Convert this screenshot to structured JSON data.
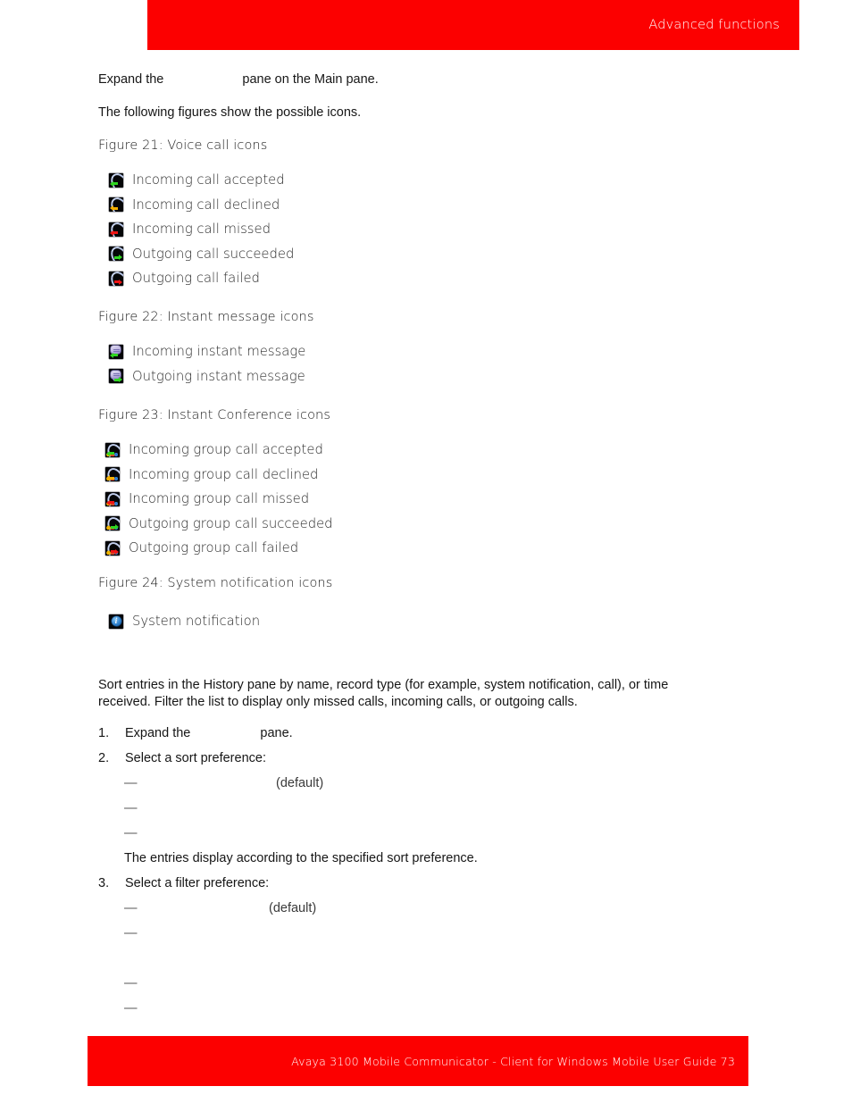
{
  "header": {
    "title": "Advanced functions",
    "banner_color": "#fc0000"
  },
  "intro": {
    "line1_before": "Expand the",
    "line1_after": "pane on the Main pane.",
    "line2": "The following figures show the possible icons."
  },
  "figures": [
    {
      "caption": "Figure 21: Voice call icons",
      "icon_kind": "voice",
      "rows": [
        {
          "label": "Incoming call accepted",
          "icon_name": "incoming-call-accepted-icon",
          "arrow_dir": "left",
          "arrow_color": "green"
        },
        {
          "label": "Incoming call declined",
          "icon_name": "incoming-call-declined-icon",
          "arrow_dir": "left",
          "arrow_color": "amber"
        },
        {
          "label": "Incoming call missed",
          "icon_name": "incoming-call-missed-icon",
          "arrow_dir": "left",
          "arrow_color": "red"
        },
        {
          "label": "Outgoing call succeeded",
          "icon_name": "outgoing-call-succeeded-icon",
          "arrow_dir": "right",
          "arrow_color": "green"
        },
        {
          "label": "Outgoing call failed",
          "icon_name": "outgoing-call-failed-icon",
          "arrow_dir": "right",
          "arrow_color": "red"
        }
      ]
    },
    {
      "caption": "Figure 22: Instant message icons",
      "icon_kind": "im",
      "rows": [
        {
          "label": "Incoming instant message",
          "icon_name": "incoming-instant-message-icon",
          "arrow_dir": "left",
          "arrow_color": "green"
        },
        {
          "label": "Outgoing instant message",
          "icon_name": "outgoing-instant-message-icon",
          "arrow_dir": "right",
          "arrow_color": "green"
        }
      ]
    },
    {
      "caption": "Figure 23: Instant Conference icons",
      "icon_kind": "group",
      "rows": [
        {
          "label": "Incoming group call accepted",
          "icon_name": "incoming-group-call-accepted-icon",
          "arrow_dir": "left",
          "arrow_color": "green"
        },
        {
          "label": "Incoming group call declined",
          "icon_name": "incoming-group-call-declined-icon",
          "arrow_dir": "left",
          "arrow_color": "amber"
        },
        {
          "label": "Incoming group call missed",
          "icon_name": "incoming-group-call-missed-icon",
          "arrow_dir": "left",
          "arrow_color": "red"
        },
        {
          "label": "Outgoing group call succeeded",
          "icon_name": "outgoing-group-call-succeeded-icon",
          "arrow_dir": "right",
          "arrow_color": "green"
        },
        {
          "label": "Outgoing group call failed",
          "icon_name": "outgoing-group-call-failed-icon",
          "arrow_dir": "right",
          "arrow_color": "red"
        }
      ]
    },
    {
      "caption": "Figure 24: System notification icons",
      "icon_kind": "info",
      "rows": [
        {
          "label": "System notification",
          "icon_name": "system-notification-icon",
          "arrow_dir": "none",
          "arrow_color": "none"
        }
      ]
    }
  ],
  "procedure": {
    "intro_paragraph": "Sort entries in the History pane by name, record type (for example, system notification, call), or time received. Filter the list to display only missed calls, incoming calls, or outgoing calls.",
    "step1": {
      "number": "1.",
      "text_before": "Expand the",
      "text_after": "pane."
    },
    "step2": {
      "number": "2.",
      "text": "Select a sort preference:"
    },
    "sort_options": [
      {
        "dash": "—",
        "suffix": "(default)"
      },
      {
        "dash": "—",
        "suffix": ""
      },
      {
        "dash": "—",
        "suffix": ""
      }
    ],
    "sort_result": "The entries display according to the specified sort preference.",
    "step3": {
      "number": "3.",
      "text": "Select a filter preference:"
    },
    "filter_options": [
      {
        "dash": "—",
        "suffix": "(default)"
      },
      {
        "dash": "—",
        "suffix": ""
      },
      {
        "dash": "—",
        "suffix": ""
      },
      {
        "dash": "—",
        "suffix": ""
      }
    ]
  },
  "footer": {
    "text": "Avaya 3100 Mobile Communicator - Client for Windows Mobile User Guide 73",
    "banner_color": "#fc0000"
  }
}
